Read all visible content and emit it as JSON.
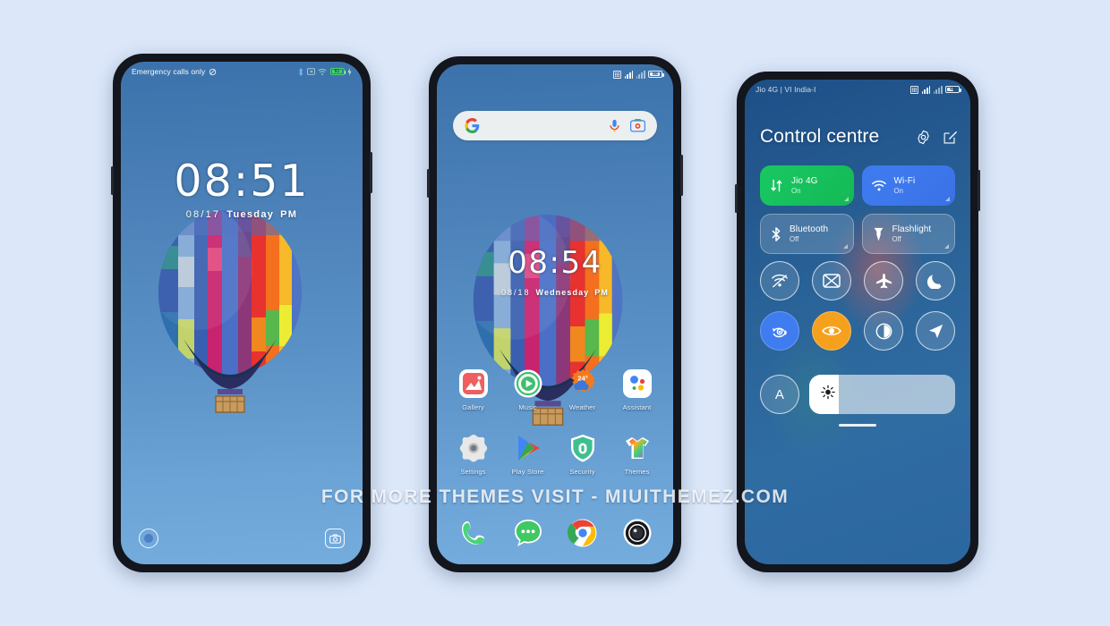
{
  "page": {
    "background_color": "#dce8fa",
    "watermark": "FOR MORE THEMES VISIT - MIUITHEMEZ.COM"
  },
  "lockscreen": {
    "status_left": "Emergency calls only",
    "status_left_icon": "no-sim-icon",
    "status_icons": [
      "bluetooth-icon",
      "screenshot-icon",
      "wifi-icon",
      "battery-icon",
      "charging-bolt-icon"
    ],
    "battery_level": "91",
    "time": "08:51",
    "date": "08/17",
    "weekday": "Tuesday",
    "meridiem": "PM",
    "left_shortcut": "flashlight-ring-icon",
    "right_shortcut": "camera-icon"
  },
  "homescreen": {
    "status_icons": [
      "sim-card-icon",
      "signal-bars-icon",
      "signal-bars-icon",
      "battery-icon"
    ],
    "battery_level": "88",
    "search": {
      "logo": "google-g-icon",
      "placeholder": "",
      "value": "",
      "mic_icon": "microphone-icon",
      "lens_icon": "google-lens-icon"
    },
    "time": "08:54",
    "date": "08/18",
    "weekday": "Wednesday",
    "meridiem": "PM",
    "apps_row1": [
      {
        "label": "Gallery",
        "icon": "gallery-icon"
      },
      {
        "label": "Music",
        "icon": "music-icon"
      },
      {
        "label": "Weather",
        "icon": "weather-icon",
        "badge": "24°"
      },
      {
        "label": "Assistant",
        "icon": "assistant-icon"
      }
    ],
    "apps_row2": [
      {
        "label": "Settings",
        "icon": "settings-icon"
      },
      {
        "label": "Play Store",
        "icon": "play-store-icon"
      },
      {
        "label": "Security",
        "icon": "security-icon"
      },
      {
        "label": "Themes",
        "icon": "themes-icon"
      }
    ],
    "dock": [
      {
        "label": "Phone",
        "icon": "phone-icon"
      },
      {
        "label": "Messages",
        "icon": "messages-icon"
      },
      {
        "label": "Chrome",
        "icon": "chrome-icon"
      },
      {
        "label": "Camera",
        "icon": "camera-icon"
      }
    ]
  },
  "controlcentre": {
    "carrier": "Jio 4G | VI India-I",
    "status_icons": [
      "sim-card-icon",
      "signal-bars-icon",
      "signal-bars-icon",
      "battery-icon"
    ],
    "battery_level": "48",
    "title": "Control centre",
    "header_icons": [
      {
        "name": "settings-gear-icon"
      },
      {
        "name": "edit-icon"
      }
    ],
    "tiles": [
      {
        "name": "Jio 4G",
        "state": "On",
        "icon": "mobile-data-icon",
        "style": "on-green"
      },
      {
        "name": "Wi-Fi",
        "state": "On",
        "icon": "wifi-icon",
        "style": "on-blue"
      },
      {
        "name": "Bluetooth",
        "state": "Off",
        "icon": "bluetooth-icon",
        "style": "off"
      },
      {
        "name": "Flashlight",
        "state": "Off",
        "icon": "flashlight-icon",
        "style": "off"
      }
    ],
    "circles_row1": [
      {
        "label": "Hotspot",
        "icon": "hotspot-icon",
        "state": "off"
      },
      {
        "label": "Cast",
        "icon": "cast-off-icon",
        "state": "off"
      },
      {
        "label": "Airplane mode",
        "icon": "airplane-icon",
        "state": "off"
      },
      {
        "label": "Dark mode",
        "icon": "moon-icon",
        "state": "off"
      }
    ],
    "circles_row2": [
      {
        "label": "Auto-rotate",
        "icon": "auto-rotate-icon",
        "state": "on-blue"
      },
      {
        "label": "Reading mode",
        "icon": "eye-icon",
        "state": "on-orange"
      },
      {
        "label": "Dark theme",
        "icon": "contrast-icon",
        "state": "off"
      },
      {
        "label": "Location",
        "icon": "location-arrow-icon",
        "state": "off"
      }
    ],
    "brightness": {
      "auto_label": "A",
      "icon": "brightness-sun-icon",
      "value": 20
    },
    "drag_handle": "drag-handle"
  }
}
